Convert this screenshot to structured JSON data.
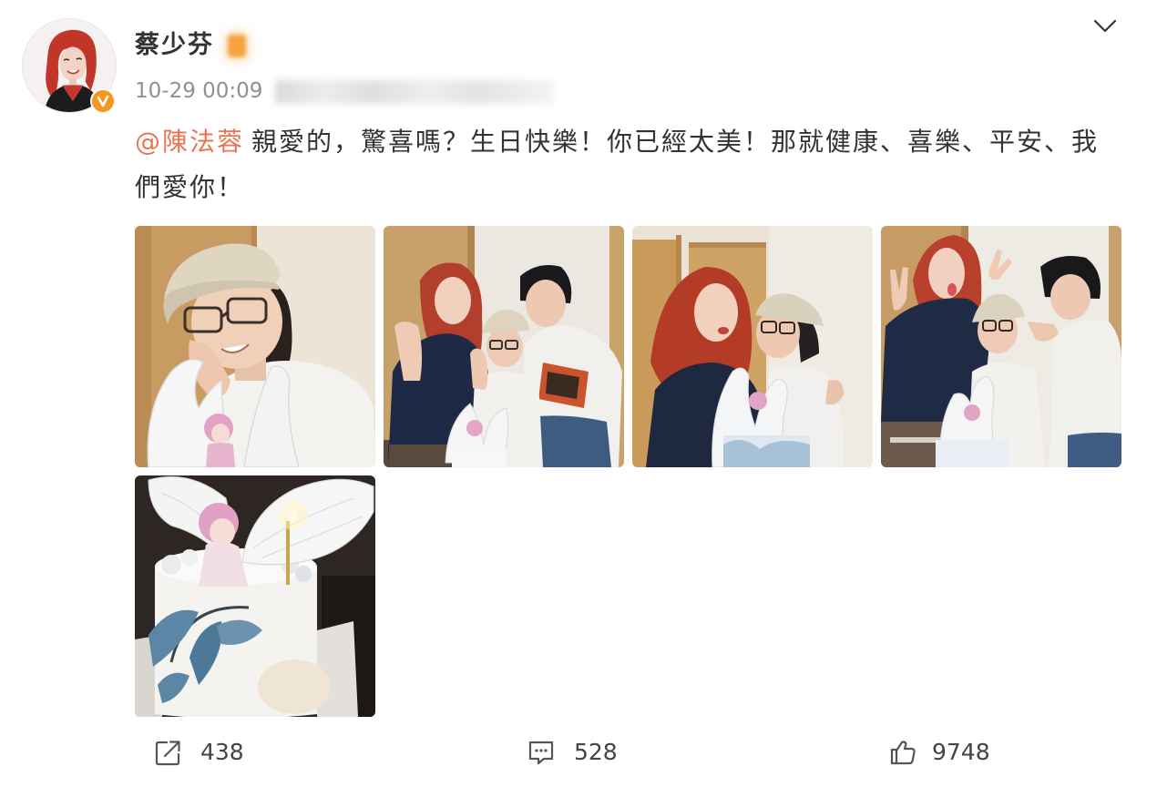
{
  "post": {
    "author": {
      "name": "蔡少芬",
      "verified": true,
      "avatar_icon": "avatar",
      "verified_icon": "verified-badge-icon",
      "member_icon": "member-badge-icon"
    },
    "timestamp": "10-29 00:09",
    "menu_icon": "chevron-down-icon",
    "content": {
      "mention": "@陳法蓉",
      "text": "親愛的，驚喜嗎？生日快樂！你已經太美！那就健康、喜樂、平安、我們愛你！"
    }
  },
  "actions": {
    "share": {
      "icon": "share-icon",
      "count": 438
    },
    "comment": {
      "icon": "comment-icon",
      "count": 528
    },
    "like": {
      "icon": "thumbs-up-icon",
      "count": 9748
    }
  },
  "colors": {
    "mention": "#eb7350",
    "text": "#333333",
    "meta": "#909090",
    "verified_badge": "#f5961d",
    "icon": "#555555"
  }
}
